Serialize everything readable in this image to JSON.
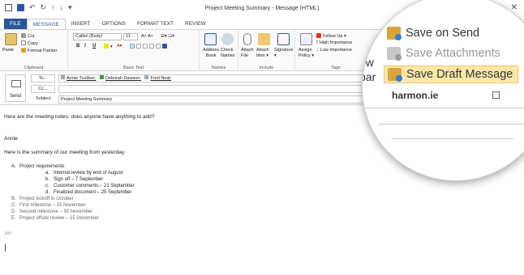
{
  "window": {
    "title": "Project Meeting Summary - Message (HTML)",
    "controls": [
      "–",
      "□",
      "✕"
    ]
  },
  "tabs": [
    "FILE",
    "MESSAGE",
    "INSERT",
    "OPTIONS",
    "FORMAT TEXT",
    "REVIEW"
  ],
  "active_tab": "MESSAGE",
  "ribbon": {
    "clipboard": {
      "paste": "Paste",
      "cut": "Cut",
      "copy": "Copy",
      "format_painter": "Format Painter",
      "label": "Clipboard"
    },
    "basic_text": {
      "font": "Calibri (Body)",
      "size": "11",
      "label": "Basic Text",
      "bold": "B",
      "italic": "I",
      "underline": "U"
    },
    "names": {
      "address_book": "Address Book",
      "address_line1": "Address",
      "address_line2": "Book",
      "check_line1": "Check",
      "check_line2": "Names",
      "label": "Names"
    },
    "include": {
      "attach_file_line1": "Attach",
      "attach_file_line2": "File",
      "attach_item_line1": "Attach",
      "attach_item_line2": "Item ▾",
      "signature": "Signature",
      "signature_arrow": "▾",
      "label": "Include"
    },
    "assign": {
      "line1": "Assign",
      "line2": "Policy ▾"
    },
    "tags": {
      "follow_up": "Follow Up ▾",
      "high": "High Importance",
      "low": "Low Importance",
      "label": "Tags"
    }
  },
  "addressing": {
    "send": "Send",
    "to_button": "To...",
    "cc_button": "Cc...",
    "subject_label": "Subject",
    "to_recipients": [
      {
        "name": "Annie Tuckker;",
        "color": "#9aa6b2"
      },
      {
        "name": "Deborah Dawson;",
        "color": "#3aa03a"
      },
      {
        "name": "Fred Neal;",
        "color": "#9aa6b2"
      }
    ],
    "cc_value": "",
    "subject_value": "Project Meeting Summary"
  },
  "body": {
    "line1": "Here are the meeting notes; does anyone have anything to add?",
    "greeting": "Annie:",
    "intro": "Here is the summary of our meeting from yesterday.",
    "items": [
      {
        "marker": "A.",
        "text": "Project requirements",
        "gray": false
      },
      {
        "marker": "a.",
        "text": "Internal review by end of August",
        "gray": false,
        "sub": true
      },
      {
        "marker": "b.",
        "text": "Sign off – 7 September",
        "gray": false,
        "sub": true
      },
      {
        "marker": "c.",
        "text": "Customer comments – 21 September",
        "gray": false,
        "sub": true
      },
      {
        "marker": "d.",
        "text": "Finalized document – 25 September",
        "gray": false,
        "sub": true
      },
      {
        "marker": "B.",
        "text": "Project kickoff in October",
        "gray": true
      },
      {
        "marker": "C.",
        "text": "First milestone – 15 November",
        "gray": true
      },
      {
        "marker": "D.",
        "text": "Second milestone – 30 November",
        "gray": true
      },
      {
        "marker": "E.",
        "text": "Project offsite review – 15 December",
        "gray": true
      }
    ],
    "signature": "Jon"
  },
  "zoom_menu": {
    "items": [
      "Save on Send",
      "Save Attachments",
      "Save Draft Message"
    ],
    "highlighted": "Save Draft Message",
    "group_label": "harmon.ie",
    "fragment_top": "ow",
    "fragment_mid": "bar"
  },
  "colors": {
    "accent": "#2b579a",
    "highlight": "#fde8a8",
    "menu_hover_border": "#f4c26b"
  }
}
